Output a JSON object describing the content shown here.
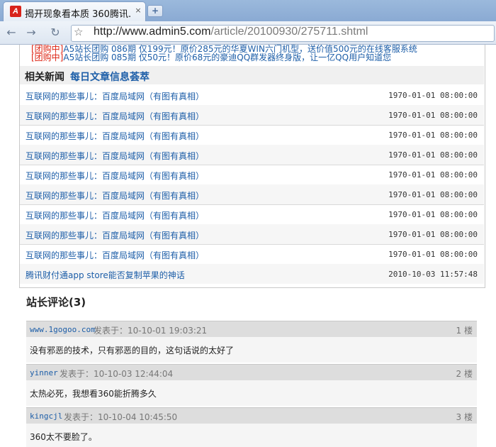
{
  "browser": {
    "tab_title": "揭开现象看本质 360腾讯...",
    "favicon_letter": "A",
    "tab_close": "×",
    "new_tab": "+",
    "url_host": "http://www.admin5.com",
    "url_path": "/article/20100930/275711.shtml",
    "back": "←",
    "forward": "→",
    "reload": "↻",
    "bookmark": "☆"
  },
  "ads": [
    {
      "tag": "[团购中]",
      "text": "A5站长团购 086期 仅199元！原价285元的华夏WIN六门机型，送价值500元的在线客服系统"
    },
    {
      "tag": "[团购中]",
      "text": "A5站长团购 085期 仅50元！原价68元的豪迪QQ群发器终身版，让一亿QQ用户知道您"
    }
  ],
  "related": {
    "label": "相关新闻",
    "sublabel": "每日文章信息荟萃",
    "items": [
      {
        "title": "互联网的那些事儿：百度局域网（有图有真相）",
        "date": "1970-01-01 08:00:00"
      },
      {
        "title": "互联网的那些事儿：百度局域网（有图有真相）",
        "date": "1970-01-01 08:00:00"
      },
      {
        "title": "互联网的那些事儿：百度局域网（有图有真相）",
        "date": "1970-01-01 08:00:00"
      },
      {
        "title": "互联网的那些事儿：百度局域网（有图有真相）",
        "date": "1970-01-01 08:00:00"
      },
      {
        "title": "互联网的那些事儿：百度局域网（有图有真相）",
        "date": "1970-01-01 08:00:00"
      },
      {
        "title": "互联网的那些事儿：百度局域网（有图有真相）",
        "date": "1970-01-01 08:00:00"
      },
      {
        "title": "互联网的那些事儿：百度局域网（有图有真相）",
        "date": "1970-01-01 08:00:00"
      },
      {
        "title": "互联网的那些事儿：百度局域网（有图有真相）",
        "date": "1970-01-01 08:00:00"
      },
      {
        "title": "互联网的那些事儿：百度局域网（有图有真相）",
        "date": "1970-01-01 08:00:00"
      },
      {
        "title": "腾讯财付通app store能否复制苹果的神话",
        "date": "2010-10-03 11:57:48"
      }
    ]
  },
  "comments": {
    "title": "站长评论(3)",
    "items": [
      {
        "user": "www.1gogoo.com",
        "time": "发表于：10-10-01 19:03:21",
        "floor": "1 楼",
        "text": "没有邪恶的技术，只有邪恶的目的，这句话说的太好了"
      },
      {
        "user": "yinner",
        "time": "发表于：10-10-03 12:44:04",
        "floor": "2 楼",
        "text": "太热必死，我想看360能折腾多久"
      },
      {
        "user": "kingcjl",
        "time": "发表于：10-10-04 10:45:50",
        "floor": "3 楼",
        "text": "360太不要脸了。"
      }
    ]
  }
}
